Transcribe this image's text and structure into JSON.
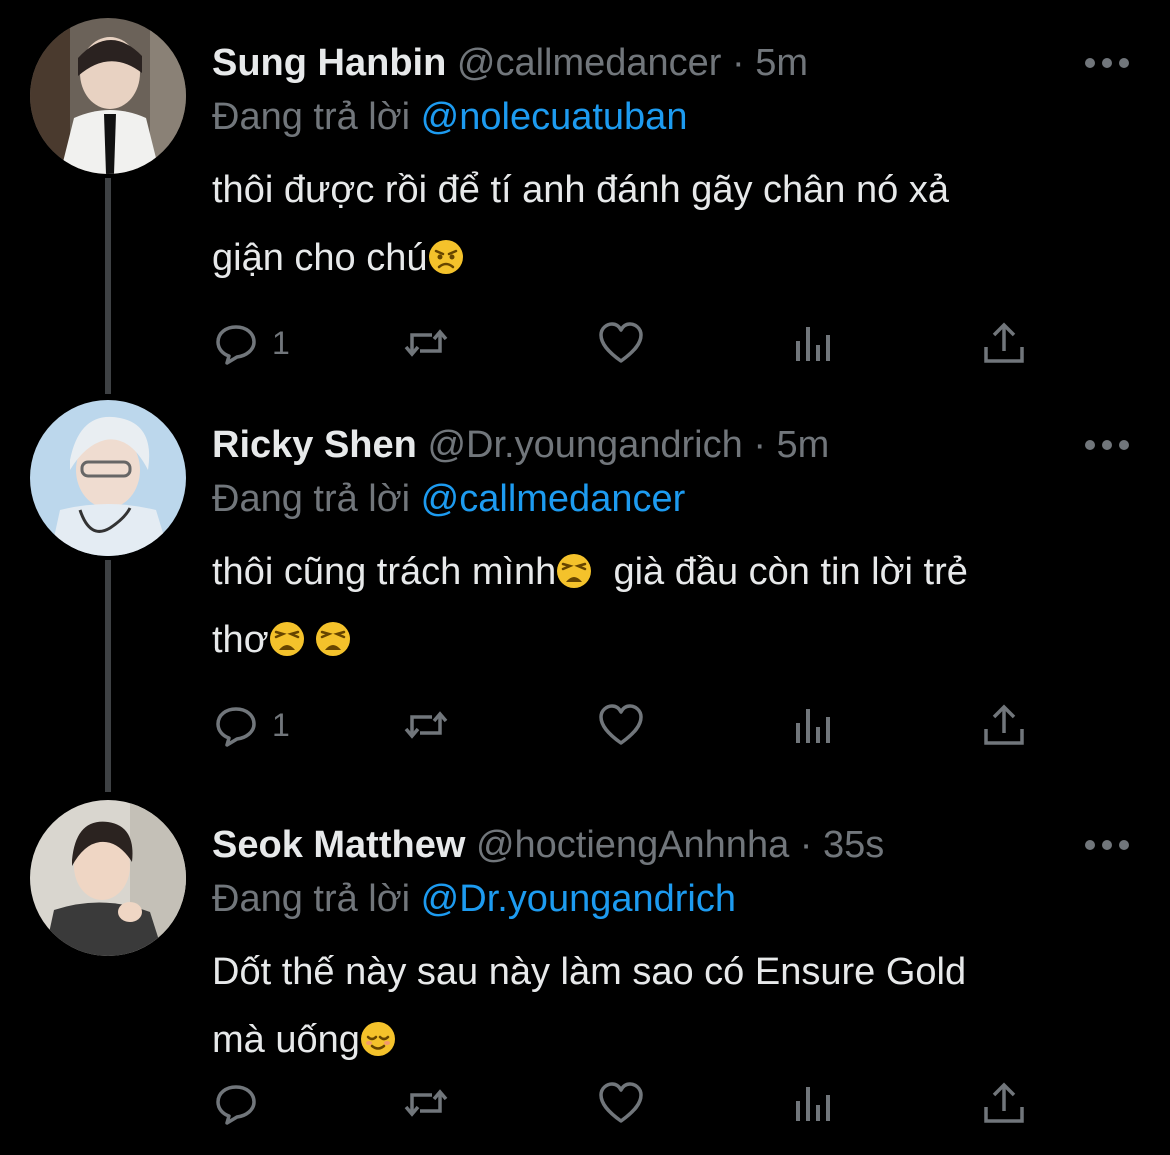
{
  "reply_prefix": "Đang trả lời",
  "colors": {
    "background": "#000000",
    "text": "#e7e9ea",
    "muted": "#71767b",
    "link": "#1d9bf0",
    "thread_line": "#3e4144"
  },
  "tweets": [
    {
      "name": "Sung Hanbin",
      "handle": "@callmedancer",
      "separator": "·",
      "time": "5m",
      "reply_to": "@nolecuatuban",
      "text_line1": "thôi được rồi để tí anh đánh gãy chân nó xả",
      "text_line2": "giận cho chú",
      "emojis": [
        "angry-face"
      ],
      "reply_count": "1"
    },
    {
      "name": "Ricky Shen",
      "handle": "@Dr.youngandrich",
      "separator": "·",
      "time": "5m",
      "reply_to": "@callmedancer",
      "text_line1a": "thôi cũng trách mình",
      "text_line1b": "già đầu còn tin lời trẻ",
      "text_line2": "thơ",
      "emojis": [
        "weary-face",
        "weary-face",
        "weary-face"
      ],
      "reply_count": "1"
    },
    {
      "name": "Seok Matthew",
      "handle": "@hoctiengAnhnha",
      "separator": "·",
      "time": "35s",
      "reply_to": "@Dr.youngandrich",
      "text_line1": "Dốt thế này sau này làm sao có Ensure Gold",
      "text_line2": "mà uống",
      "emojis": [
        "relieved-face"
      ],
      "reply_count": ""
    }
  ]
}
